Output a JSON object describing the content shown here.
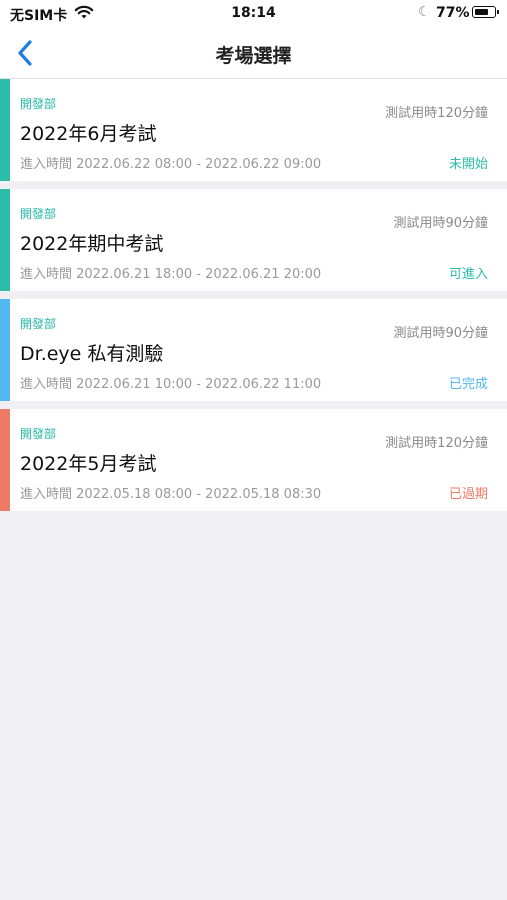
{
  "status_bar": {
    "carrier": "无SIM卡",
    "time": "18:14",
    "battery_percent": "77%",
    "battery_level": 0.77
  },
  "nav": {
    "title": "考場選擇",
    "back_icon": "chevron-left-icon"
  },
  "colors": {
    "teal": "#2bbcaa",
    "blue": "#52b7f2",
    "red": "#ee7a68",
    "back_blue": "#1f7be8"
  },
  "exams": [
    {
      "department": "開發部",
      "name": "2022年6月考試",
      "duration": "測試用時120分鐘",
      "period": "進入時間 2022.06.22 08:00 - 2022.06.22 09:00",
      "status": "未開始",
      "bar_color": "#2bbcaa",
      "status_color": "#2bbcaa"
    },
    {
      "department": "開發部",
      "name": "2022年期中考試",
      "duration": "測試用時90分鐘",
      "period": "進入時間 2022.06.21 18:00 - 2022.06.21 20:00",
      "status": "可進入",
      "bar_color": "#2bbcaa",
      "status_color": "#2bbcaa"
    },
    {
      "department": "開發部",
      "name": "Dr.eye 私有測驗",
      "duration": "測試用時90分鐘",
      "period": "進入時間 2022.06.21 10:00 - 2022.06.22 11:00",
      "status": "已完成",
      "bar_color": "#52b7f2",
      "status_color": "#52b7f2"
    },
    {
      "department": "開發部",
      "name": "2022年5月考試",
      "duration": "測試用時120分鐘",
      "period": "進入時間 2022.05.18 08:00 - 2022.05.18 08:30",
      "status": "已過期",
      "bar_color": "#ee7a68",
      "status_color": "#ee7a68"
    }
  ]
}
